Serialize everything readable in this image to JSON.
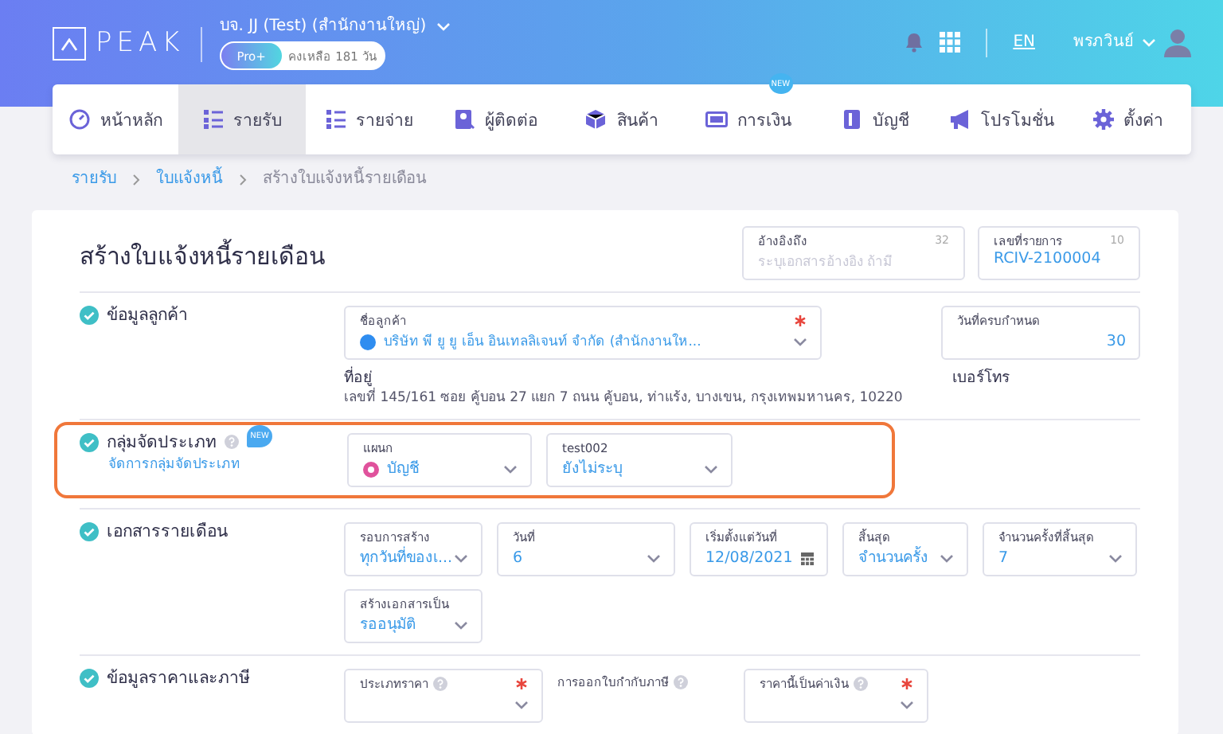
{
  "header": {
    "logo": "PEAK",
    "company": "บจ. JJ (Test) (สำนักงานใหญ่)",
    "plan": "Pro+",
    "remaining": "คงเหลือ 181 วัน",
    "language": "EN",
    "user": "พรภวินย์"
  },
  "nav": [
    {
      "label": "หน้าหลัก",
      "selected": false
    },
    {
      "label": "รายรับ",
      "selected": true
    },
    {
      "label": "รายจ่าย",
      "selected": false
    },
    {
      "label": "ผู้ติดต่อ",
      "selected": false
    },
    {
      "label": "สินค้า",
      "selected": false
    },
    {
      "label": "การเงิน",
      "selected": false,
      "badge": "NEW"
    },
    {
      "label": "บัญชี",
      "selected": false
    },
    {
      "label": "โปรโมชั่น",
      "selected": false
    },
    {
      "label": "ตั้งค่า",
      "selected": false
    }
  ],
  "breadcrumb": [
    {
      "label": "รายรับ",
      "kind": "link"
    },
    {
      "label": "ใบแจ้งหนี้",
      "kind": "link"
    },
    {
      "label": "สร้างใบแจ้งหนี้รายเดือน",
      "kind": "current"
    }
  ],
  "form": {
    "title": "สร้างใบแจ้งหนี้รายเดือน",
    "top_fields": [
      {
        "label": "อ้างอิงถึง",
        "counter": "32",
        "placeholder": "ระบุเอกสารอ้างอิง ถ้ามี"
      },
      {
        "label": "เลขที่รายการ",
        "counter": "10",
        "value": "RCIV-2100004"
      }
    ],
    "sections": [
      {
        "kind": "customer",
        "title": "ข้อมูลลูกค้า",
        "complete": true,
        "rows": [
          [
            {
              "kind": "select",
              "label": "ชื่อลูกค้า",
              "value": "บริษัท พี ยู ยู เอ็น อินเทลลิเจนท์ จำกัด (สำนักงานให...",
              "required": true,
              "avatar": true
            },
            {
              "kind": "number",
              "label": "วันที่ครบกำหนด",
              "value": "30"
            }
          ]
        ],
        "address_label": "ที่อยู่",
        "address": "เลขที่ 145/161 ซอย คู้บอน 27 แยก 7 ถนน คู้บอน, ท่าแร้ง, บางเขน, กรุงเทพมหานคร, 10220",
        "phone_label": "เบอร์โทร"
      },
      {
        "kind": "classification",
        "title": "กลุ่มจัดประเภท",
        "complete": true,
        "help": true,
        "badge": "NEW",
        "link": "จัดการกลุ่มจัดประเภท",
        "highlighted": true,
        "rows": [
          [
            {
              "kind": "select",
              "label": "แผนก",
              "value": "บัญชี",
              "color": "#e0529c"
            },
            {
              "kind": "select",
              "label": "test002",
              "value": "ยังไม่ระบุ"
            }
          ]
        ]
      },
      {
        "kind": "recurring",
        "title": "เอกสารรายเดือน",
        "complete": true,
        "rows": [
          [
            {
              "kind": "select",
              "label": "รอบการสร้าง",
              "value": "ทุกวันที่ของเ..."
            },
            {
              "kind": "select",
              "label": "วันที่",
              "value": "6"
            },
            {
              "kind": "date",
              "label": "เริ่มตั้งแต่วันที่",
              "value": "12/08/2021"
            },
            {
              "kind": "select",
              "label": "สิ้นสุด",
              "value": "จำนวนครั้ง"
            },
            {
              "kind": "select",
              "label": "จำนวนครั้งที่สิ้นสุด",
              "value": "7"
            }
          ],
          [
            {
              "kind": "select",
              "label": "สร้างเอกสารเป็น",
              "value": "รออนุมัติ"
            }
          ]
        ]
      },
      {
        "kind": "pricing",
        "title": "ข้อมูลราคาและภาษี",
        "complete": true,
        "rows": [
          [
            {
              "kind": "select",
              "label": "ประเภทราคา",
              "help": true,
              "required": true
            },
            {
              "kind": "caption",
              "label": "การออกใบกำกับภาษี",
              "help": true
            },
            {
              "kind": "select",
              "label": "ราคานี้เป็นค่าเงิน",
              "help": true,
              "required": true
            }
          ]
        ]
      }
    ]
  }
}
